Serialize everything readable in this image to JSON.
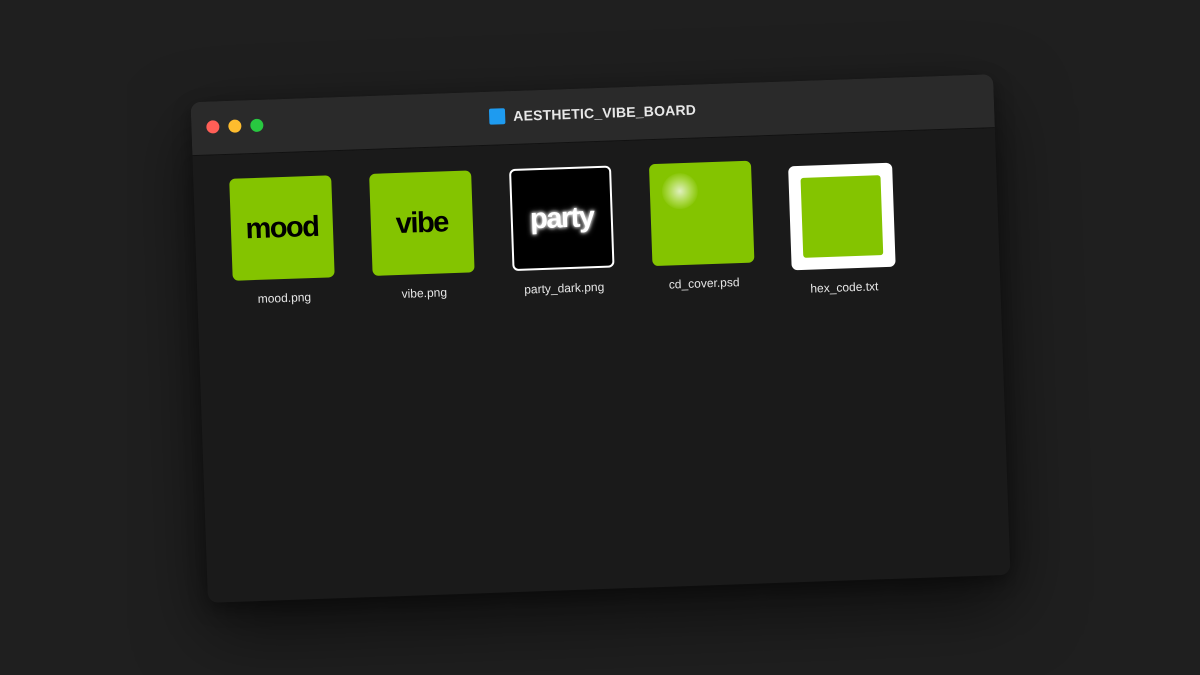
{
  "window": {
    "title": "AESTHETIC_VIBE_BOARD",
    "title_icon": "folder-icon",
    "controls": [
      "close",
      "minimize",
      "zoom"
    ]
  },
  "colors": {
    "accent_green": "#84c400",
    "folder_blue": "#1e9bf0",
    "window_bg": "#1a1a1a",
    "titlebar_bg": "#2a2a2a",
    "desktop_bg": "#1f1f1f"
  },
  "files": [
    {
      "name": "mood.png",
      "thumb_text": "mood",
      "thumb_style": "green-text"
    },
    {
      "name": "vibe.png",
      "thumb_text": "vibe",
      "thumb_style": "green-text"
    },
    {
      "name": "party_dark.png",
      "thumb_text": "party",
      "thumb_style": "black-glow-text"
    },
    {
      "name": "cd_cover.psd",
      "thumb_text": "",
      "thumb_style": "green-glow"
    },
    {
      "name": "hex_code.txt",
      "thumb_text": "",
      "thumb_style": "white-frame-green"
    }
  ]
}
